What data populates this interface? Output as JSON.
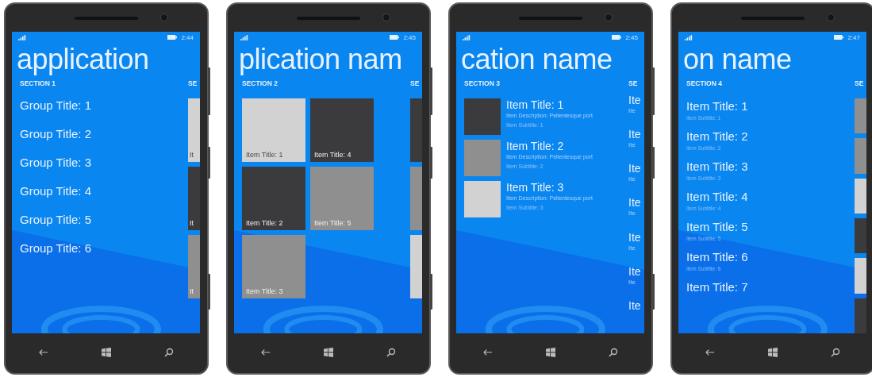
{
  "phones": [
    {
      "time": "2:44",
      "title": "application",
      "section": "SECTION 1",
      "next_section": "SE",
      "kind": "groups",
      "items": [
        {
          "title": "Group Title: 1"
        },
        {
          "title": "Group Title: 2"
        },
        {
          "title": "Group Title: 3"
        },
        {
          "title": "Group Title: 4"
        },
        {
          "title": "Group Title: 5"
        },
        {
          "title": "Group Title: 6"
        }
      ],
      "peek": [
        {
          "kind": "tile",
          "color": "#d2d2d2",
          "label": "It"
        },
        {
          "kind": "tile",
          "color": "#3b3b3d",
          "label": "It"
        },
        {
          "kind": "tile",
          "color": "#8f8f8f",
          "label": "It"
        }
      ]
    },
    {
      "time": "2:45",
      "title": "plication nam",
      "section": "SECTION 2",
      "next_section": "SE",
      "kind": "tiles",
      "items": [
        {
          "title": "Item Title: 1",
          "color": "#d2d2d2"
        },
        {
          "title": "Item Title: 2",
          "color": "#3b3b3d"
        },
        {
          "title": "Item Title: 3",
          "color": "#8f8f8f"
        },
        {
          "title": "Item Title: 4",
          "color": "#3b3b3d"
        },
        {
          "title": "Item Title: 5",
          "color": "#8f8f8f"
        }
      ],
      "peek": [
        {
          "kind": "tile",
          "color": "#3b3b3d"
        },
        {
          "kind": "tile",
          "color": "#8f8f8f"
        },
        {
          "kind": "tile",
          "color": "#d2d2d2"
        }
      ]
    },
    {
      "time": "2:45",
      "title": "cation name",
      "section": "SECTION 3",
      "next_section": "SE",
      "kind": "details",
      "items": [
        {
          "title": "Item Title: 1",
          "description": "Item Description: Pellentesque port",
          "subtitle": "Item Subtitle: 1",
          "color": "#3b3b3d"
        },
        {
          "title": "Item Title: 2",
          "description": "Item Description: Pellentesque port",
          "subtitle": "Item Subtitle: 2",
          "color": "#8f8f8f"
        },
        {
          "title": "Item Title: 3",
          "description": "Item Description: Pellentesque port",
          "subtitle": "Item Subtitle: 3",
          "color": "#d2d2d2"
        }
      ],
      "peek": [
        {
          "kind": "text",
          "title": "Ite",
          "subtitle": "Ite"
        },
        {
          "kind": "text",
          "title": "Ite",
          "subtitle": "Ite"
        },
        {
          "kind": "text",
          "title": "Ite",
          "subtitle": "Ite"
        },
        {
          "kind": "text",
          "title": "Ite",
          "subtitle": "Ite"
        },
        {
          "kind": "text",
          "title": "Ite",
          "subtitle": "Ite"
        },
        {
          "kind": "text",
          "title": "Ite",
          "subtitle": "Ite"
        },
        {
          "kind": "text",
          "title": "Ite"
        }
      ]
    },
    {
      "time": "2:47",
      "title": "on name",
      "section": "SECTION 4",
      "next_section": "SE",
      "kind": "list",
      "items": [
        {
          "title": "Item Title: 1",
          "subtitle": "Item Subtitle: 1"
        },
        {
          "title": "Item Title: 2",
          "subtitle": "Item Subtitle: 2"
        },
        {
          "title": "Item Title: 3",
          "subtitle": "Item Subtitle: 3"
        },
        {
          "title": "Item Title: 4",
          "subtitle": "Item Subtitle: 4"
        },
        {
          "title": "Item Title: 5",
          "subtitle": "Item Subtitle: 5"
        },
        {
          "title": "Item Title: 6",
          "subtitle": "Item Subtitle: 6"
        },
        {
          "title": "Item Title: 7"
        }
      ],
      "peek": [
        {
          "kind": "tile",
          "color": "#8f8f8f"
        },
        {
          "kind": "tile",
          "color": "#8f8f8f"
        },
        {
          "kind": "tile",
          "color": "#d2d2d2"
        },
        {
          "kind": "tile",
          "color": "#3b3b3d"
        },
        {
          "kind": "tile",
          "color": "#d2d2d2"
        },
        {
          "kind": "tile",
          "color": "#3b3b3d"
        }
      ]
    }
  ]
}
